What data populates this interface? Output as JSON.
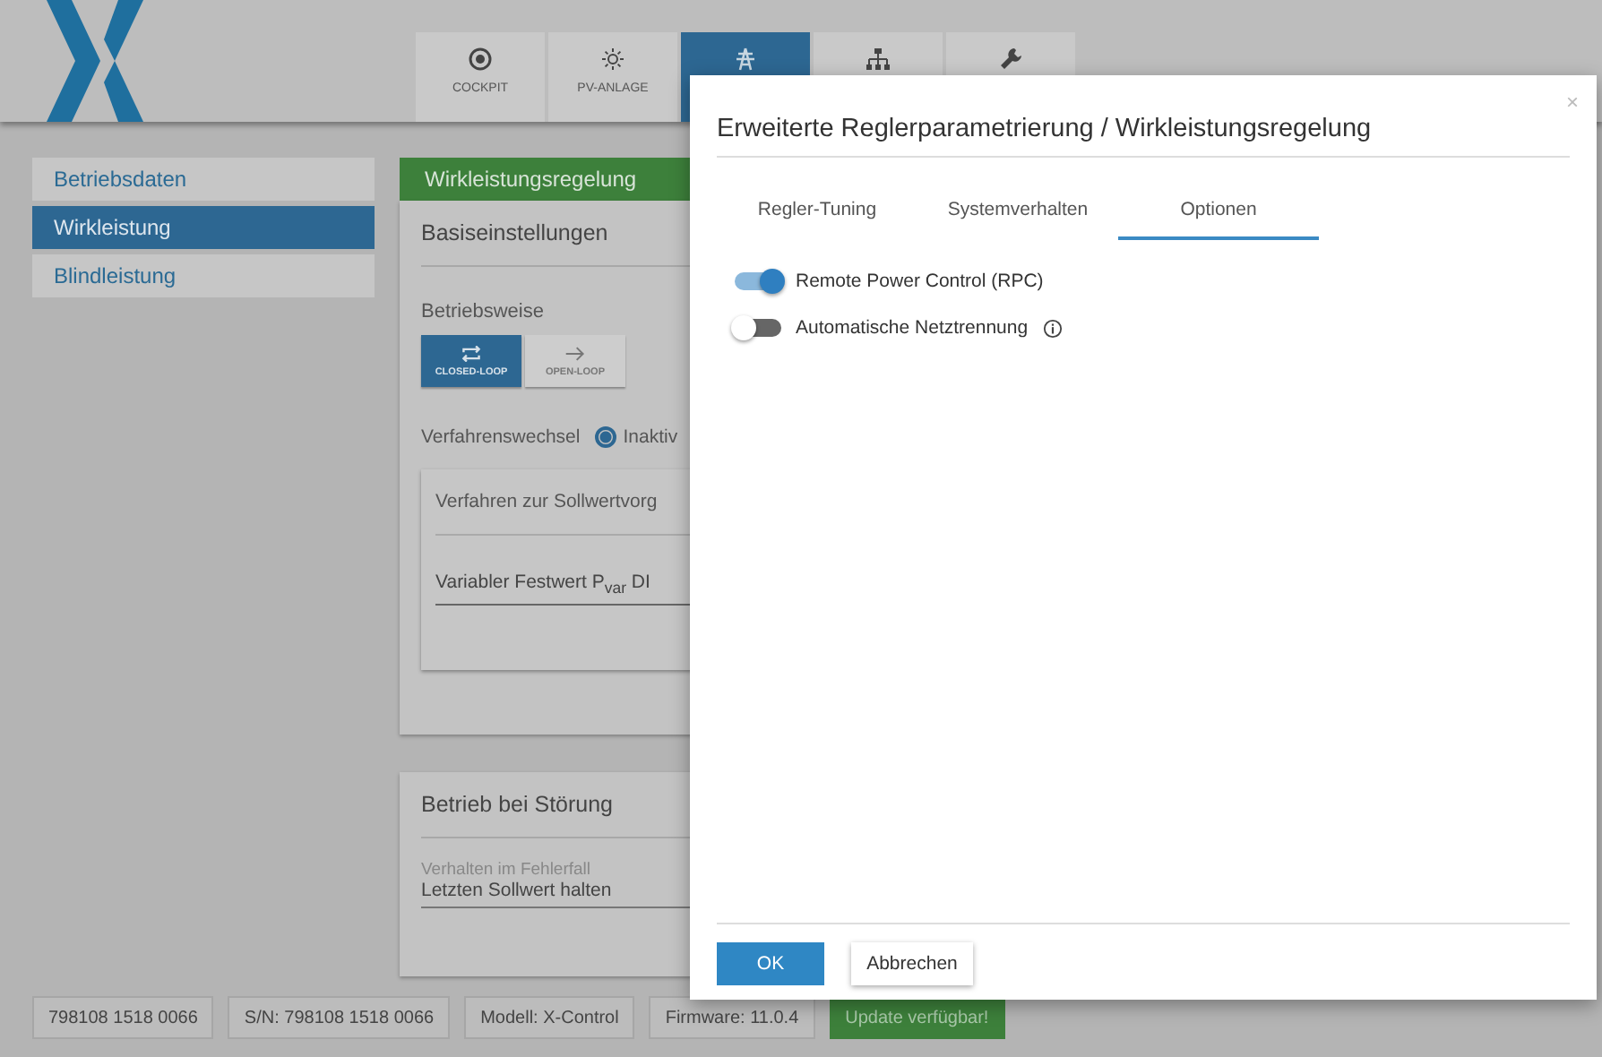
{
  "nav_tabs": [
    {
      "label": "COCKPIT",
      "selected": false
    },
    {
      "label": "PV-ANLAGE",
      "selected": false
    },
    {
      "selected": true
    },
    {
      "selected": false
    },
    {
      "selected": false
    }
  ],
  "sidebar": {
    "items": [
      {
        "label": "Betriebsdaten",
        "selected": false
      },
      {
        "label": "Wirkleistung",
        "selected": true
      },
      {
        "label": "Blindleistung",
        "selected": false
      }
    ]
  },
  "panel": {
    "title": "Wirkleistungsregelung",
    "section": "Basiseinstellungen",
    "mode_label": "Betriebsweise",
    "modes": [
      {
        "label": "CLOSED-LOOP",
        "selected": true
      },
      {
        "label": "OPEN-LOOP",
        "selected": false
      }
    ],
    "switch_label": "Verfahrenswechsel",
    "switch_option": {
      "label": "Inaktiv",
      "selected": true
    },
    "subpanel": {
      "title": "Verfahren zur Sollwertvorg",
      "value": "Variabler Festwert P$_{var}$ DI"
    }
  },
  "fault_panel": {
    "title": "Betrieb bei Störung",
    "field_label": "Verhalten im Fehlerfall",
    "field_value": "Letzten Sollwert halten"
  },
  "status_bar": [
    {
      "text": "798108 1518 0066",
      "kind": "info"
    },
    {
      "text": "S/N: 798108 1518 0066",
      "kind": "info"
    },
    {
      "text": "Modell: X-Control",
      "kind": "info"
    },
    {
      "text": "Firmware: 11.0.4",
      "kind": "info"
    },
    {
      "text": "Update verfügbar!",
      "kind": "update"
    }
  ],
  "dialog": {
    "title": "Erweiterte Reglerparametrierung / Wirkleistungsregelung",
    "close": "×",
    "tabs": [
      {
        "label": "Regler-Tuning",
        "selected": false
      },
      {
        "label": "Systemverhalten",
        "selected": false
      },
      {
        "label": "Optionen",
        "selected": true
      }
    ],
    "options": [
      {
        "label": "Remote Power Control (RPC)",
        "on": true,
        "info": false
      },
      {
        "label": "Automatische Netztrennung",
        "on": false,
        "info": true
      }
    ],
    "buttons": [
      {
        "label": "OK",
        "kind": "primary"
      },
      {
        "label": "Abbrechen",
        "kind": "secondary"
      }
    ]
  }
}
